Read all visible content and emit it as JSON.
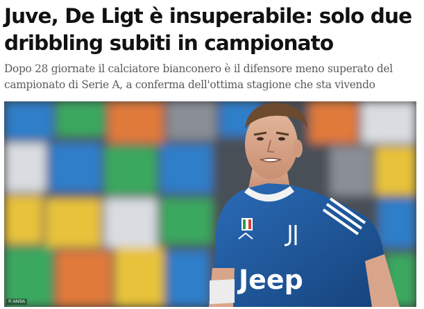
{
  "article": {
    "headline_lines": [
      "Juve, De Ligt è insuperabile: solo due",
      "dribbling subiti in campionato"
    ],
    "subtitle_lines": [
      "Dopo 28 giornate il calciatore bianconero è il difensore meno superato del",
      "campionato di Serie A, a conferma dell'ottima stagione che sta vivendo"
    ]
  },
  "photo": {
    "credit": "ANSA",
    "credit_icon": "copyright-icon",
    "jersey_sponsor": "Jeep",
    "colors": {
      "jersey": "#1f5fa8",
      "stands": [
        "#2f7ec9",
        "#e07a3a",
        "#3aa860",
        "#e8c23a",
        "#8a8f96"
      ]
    }
  }
}
